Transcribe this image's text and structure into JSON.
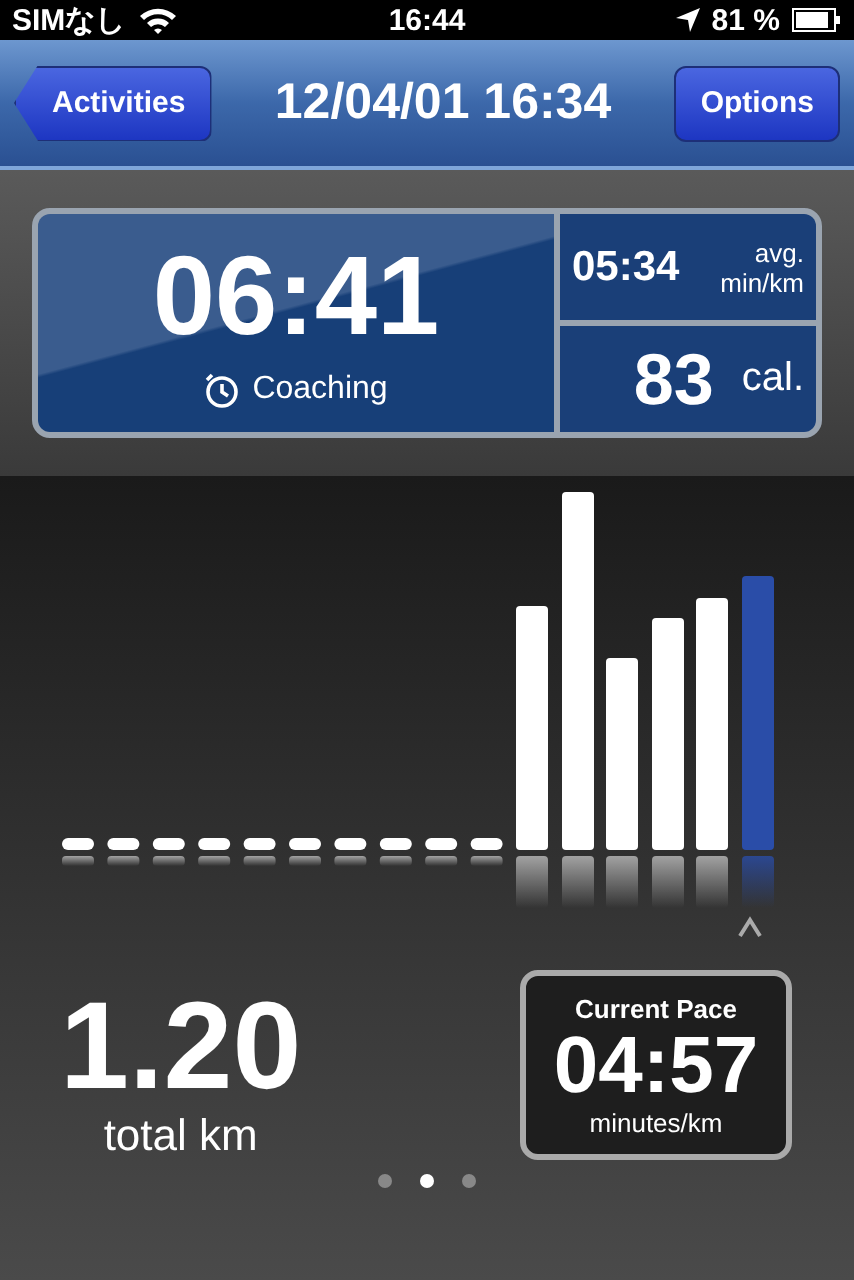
{
  "status_bar": {
    "carrier": "SIMなし",
    "time": "16:44",
    "battery": "81 %"
  },
  "nav_bar": {
    "back_button": "Activities",
    "title": "12/04/01 16:34",
    "options_button": "Options"
  },
  "stats": {
    "duration": "06:41",
    "coaching": "Coaching",
    "avg_pace": "05:34",
    "avg_pace_label_1": "avg.",
    "avg_pace_label_2": "min/km",
    "calories": "83",
    "calories_unit": "cal."
  },
  "distance": {
    "value": "1.20",
    "label": "total km"
  },
  "current_pace": {
    "title": "Current Pace",
    "value": "04:57",
    "unit": "minutes/km"
  },
  "pager": [
    {
      "selected": false
    },
    {
      "selected": true
    },
    {
      "selected": false
    }
  ]
}
